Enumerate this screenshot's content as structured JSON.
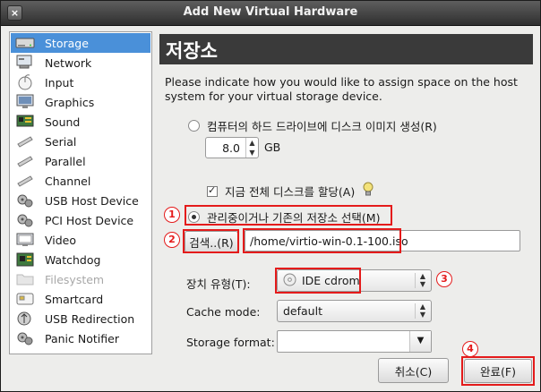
{
  "window": {
    "title": "Add New Virtual Hardware",
    "close_glyph": "×"
  },
  "sidebar": {
    "items": [
      {
        "label": "Storage",
        "icon": "hard-disk-icon",
        "selected": true
      },
      {
        "label": "Network",
        "icon": "network-card-icon"
      },
      {
        "label": "Input",
        "icon": "mouse-icon"
      },
      {
        "label": "Graphics",
        "icon": "monitor-icon"
      },
      {
        "label": "Sound",
        "icon": "sound-card-icon"
      },
      {
        "label": "Serial",
        "icon": "serial-port-icon"
      },
      {
        "label": "Parallel",
        "icon": "parallel-port-icon"
      },
      {
        "label": "Channel",
        "icon": "channel-icon"
      },
      {
        "label": "USB Host Device",
        "icon": "usb-device-icon"
      },
      {
        "label": "PCI Host Device",
        "icon": "pci-device-icon"
      },
      {
        "label": "Video",
        "icon": "video-icon"
      },
      {
        "label": "Watchdog",
        "icon": "watchdog-chip-icon"
      },
      {
        "label": "Filesystem",
        "icon": "folder-icon",
        "disabled": true
      },
      {
        "label": "Smartcard",
        "icon": "smartcard-icon"
      },
      {
        "label": "USB Redirection",
        "icon": "usb-redirection-icon"
      },
      {
        "label": "Panic Notifier",
        "icon": "panic-notifier-icon"
      }
    ]
  },
  "main": {
    "heading": "저장소",
    "description": "Please indicate how you would like to assign space on the host system for your virtual storage device.",
    "option_create": "컴퓨터의 하드 드라이브에 디스크 이미지 생성(R)",
    "size_value": "8.0",
    "size_unit": "GB",
    "allocate_label": "지금 전체 디스크를 할당(A)",
    "option_select": "관리중이거나 기존의 저장소 선택(M)",
    "browse_label": "검색..(R)",
    "path_value": "/home/virtio-win-0.1-100.iso",
    "device_type_label": "장치 유형(T):",
    "device_type_value": "IDE cdrom",
    "cache_mode_label": "Cache mode:",
    "cache_mode_value": "default",
    "storage_format_label": "Storage format:",
    "storage_format_value": "",
    "cancel_label": "취소(C)",
    "finish_label": "완료(F)"
  },
  "annotations": {
    "marker_1": "1",
    "marker_2": "2",
    "marker_3": "3",
    "marker_4": "4",
    "highlight_color": "#e41b1b"
  }
}
